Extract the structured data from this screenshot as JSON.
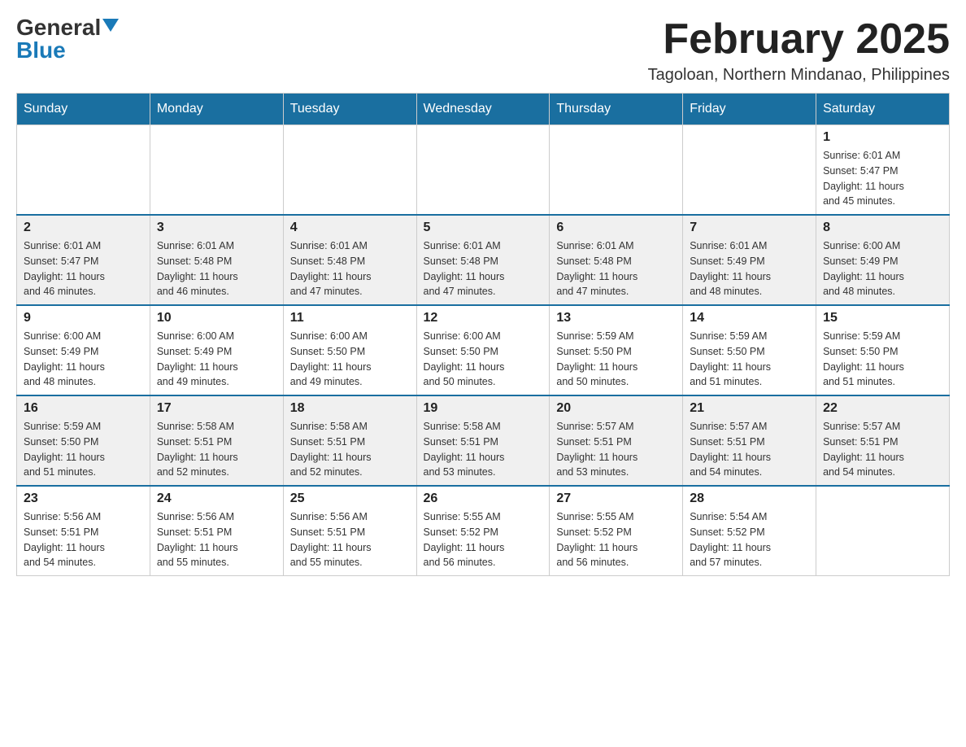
{
  "logo": {
    "general": "General",
    "blue": "Blue"
  },
  "title": {
    "month": "February 2025",
    "location": "Tagoloan, Northern Mindanao, Philippines"
  },
  "days_header": [
    "Sunday",
    "Monday",
    "Tuesday",
    "Wednesday",
    "Thursday",
    "Friday",
    "Saturday"
  ],
  "weeks": [
    {
      "days": [
        {
          "number": "",
          "info": ""
        },
        {
          "number": "",
          "info": ""
        },
        {
          "number": "",
          "info": ""
        },
        {
          "number": "",
          "info": ""
        },
        {
          "number": "",
          "info": ""
        },
        {
          "number": "",
          "info": ""
        },
        {
          "number": "1",
          "info": "Sunrise: 6:01 AM\nSunset: 5:47 PM\nDaylight: 11 hours\nand 45 minutes."
        }
      ]
    },
    {
      "days": [
        {
          "number": "2",
          "info": "Sunrise: 6:01 AM\nSunset: 5:47 PM\nDaylight: 11 hours\nand 46 minutes."
        },
        {
          "number": "3",
          "info": "Sunrise: 6:01 AM\nSunset: 5:48 PM\nDaylight: 11 hours\nand 46 minutes."
        },
        {
          "number": "4",
          "info": "Sunrise: 6:01 AM\nSunset: 5:48 PM\nDaylight: 11 hours\nand 47 minutes."
        },
        {
          "number": "5",
          "info": "Sunrise: 6:01 AM\nSunset: 5:48 PM\nDaylight: 11 hours\nand 47 minutes."
        },
        {
          "number": "6",
          "info": "Sunrise: 6:01 AM\nSunset: 5:48 PM\nDaylight: 11 hours\nand 47 minutes."
        },
        {
          "number": "7",
          "info": "Sunrise: 6:01 AM\nSunset: 5:49 PM\nDaylight: 11 hours\nand 48 minutes."
        },
        {
          "number": "8",
          "info": "Sunrise: 6:00 AM\nSunset: 5:49 PM\nDaylight: 11 hours\nand 48 minutes."
        }
      ]
    },
    {
      "days": [
        {
          "number": "9",
          "info": "Sunrise: 6:00 AM\nSunset: 5:49 PM\nDaylight: 11 hours\nand 48 minutes."
        },
        {
          "number": "10",
          "info": "Sunrise: 6:00 AM\nSunset: 5:49 PM\nDaylight: 11 hours\nand 49 minutes."
        },
        {
          "number": "11",
          "info": "Sunrise: 6:00 AM\nSunset: 5:50 PM\nDaylight: 11 hours\nand 49 minutes."
        },
        {
          "number": "12",
          "info": "Sunrise: 6:00 AM\nSunset: 5:50 PM\nDaylight: 11 hours\nand 50 minutes."
        },
        {
          "number": "13",
          "info": "Sunrise: 5:59 AM\nSunset: 5:50 PM\nDaylight: 11 hours\nand 50 minutes."
        },
        {
          "number": "14",
          "info": "Sunrise: 5:59 AM\nSunset: 5:50 PM\nDaylight: 11 hours\nand 51 minutes."
        },
        {
          "number": "15",
          "info": "Sunrise: 5:59 AM\nSunset: 5:50 PM\nDaylight: 11 hours\nand 51 minutes."
        }
      ]
    },
    {
      "days": [
        {
          "number": "16",
          "info": "Sunrise: 5:59 AM\nSunset: 5:50 PM\nDaylight: 11 hours\nand 51 minutes."
        },
        {
          "number": "17",
          "info": "Sunrise: 5:58 AM\nSunset: 5:51 PM\nDaylight: 11 hours\nand 52 minutes."
        },
        {
          "number": "18",
          "info": "Sunrise: 5:58 AM\nSunset: 5:51 PM\nDaylight: 11 hours\nand 52 minutes."
        },
        {
          "number": "19",
          "info": "Sunrise: 5:58 AM\nSunset: 5:51 PM\nDaylight: 11 hours\nand 53 minutes."
        },
        {
          "number": "20",
          "info": "Sunrise: 5:57 AM\nSunset: 5:51 PM\nDaylight: 11 hours\nand 53 minutes."
        },
        {
          "number": "21",
          "info": "Sunrise: 5:57 AM\nSunset: 5:51 PM\nDaylight: 11 hours\nand 54 minutes."
        },
        {
          "number": "22",
          "info": "Sunrise: 5:57 AM\nSunset: 5:51 PM\nDaylight: 11 hours\nand 54 minutes."
        }
      ]
    },
    {
      "days": [
        {
          "number": "23",
          "info": "Sunrise: 5:56 AM\nSunset: 5:51 PM\nDaylight: 11 hours\nand 54 minutes."
        },
        {
          "number": "24",
          "info": "Sunrise: 5:56 AM\nSunset: 5:51 PM\nDaylight: 11 hours\nand 55 minutes."
        },
        {
          "number": "25",
          "info": "Sunrise: 5:56 AM\nSunset: 5:51 PM\nDaylight: 11 hours\nand 55 minutes."
        },
        {
          "number": "26",
          "info": "Sunrise: 5:55 AM\nSunset: 5:52 PM\nDaylight: 11 hours\nand 56 minutes."
        },
        {
          "number": "27",
          "info": "Sunrise: 5:55 AM\nSunset: 5:52 PM\nDaylight: 11 hours\nand 56 minutes."
        },
        {
          "number": "28",
          "info": "Sunrise: 5:54 AM\nSunset: 5:52 PM\nDaylight: 11 hours\nand 57 minutes."
        },
        {
          "number": "",
          "info": ""
        }
      ]
    }
  ]
}
